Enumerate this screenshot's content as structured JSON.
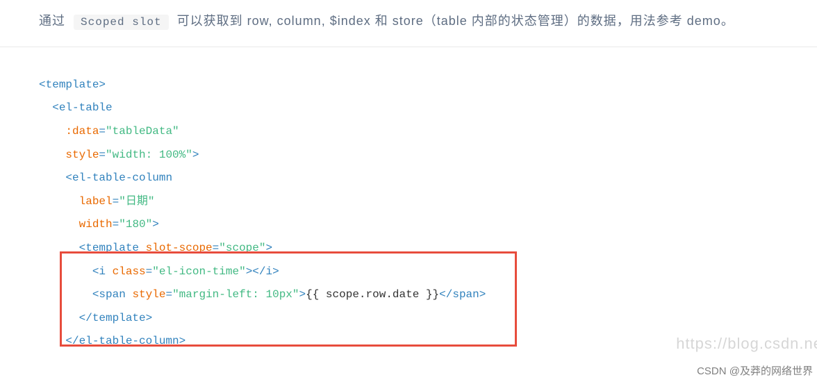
{
  "description": {
    "before": "通过",
    "code_label": "Scoped slot",
    "after": "可以获取到 row, column, $index 和 store（table 内部的状态管理）的数据，用法参考 demo。"
  },
  "code": {
    "lines": [
      {
        "indent": 0,
        "tokens": [
          [
            "punct",
            "<"
          ],
          [
            "tag",
            "template"
          ],
          [
            "punct",
            ">"
          ]
        ]
      },
      {
        "indent": 1,
        "tokens": [
          [
            "punct",
            "<"
          ],
          [
            "tag",
            "el-table"
          ]
        ]
      },
      {
        "indent": 2,
        "tokens": [
          [
            "attr-name",
            ":data"
          ],
          [
            "punct",
            "="
          ],
          [
            "attr-val",
            "\"tableData\""
          ]
        ]
      },
      {
        "indent": 2,
        "tokens": [
          [
            "attr-name",
            "style"
          ],
          [
            "punct",
            "="
          ],
          [
            "attr-val",
            "\"width: 100%\""
          ],
          [
            "punct",
            ">"
          ]
        ]
      },
      {
        "indent": 2,
        "tokens": [
          [
            "punct",
            "<"
          ],
          [
            "tag",
            "el-table-column"
          ]
        ]
      },
      {
        "indent": 3,
        "tokens": [
          [
            "attr-name",
            "label"
          ],
          [
            "punct",
            "="
          ],
          [
            "attr-val",
            "\"日期\""
          ]
        ]
      },
      {
        "indent": 3,
        "tokens": [
          [
            "attr-name",
            "width"
          ],
          [
            "punct",
            "="
          ],
          [
            "attr-val",
            "\"180\""
          ],
          [
            "punct",
            ">"
          ]
        ]
      },
      {
        "indent": 3,
        "tokens": [
          [
            "punct",
            "<"
          ],
          [
            "tag",
            "template"
          ],
          [
            "plain",
            " "
          ],
          [
            "attr-name",
            "slot-scope"
          ],
          [
            "punct",
            "="
          ],
          [
            "attr-val",
            "\"scope\""
          ],
          [
            "punct",
            ">"
          ]
        ]
      },
      {
        "indent": 4,
        "tokens": [
          [
            "punct",
            "<"
          ],
          [
            "tag",
            "i"
          ],
          [
            "plain",
            " "
          ],
          [
            "attr-name",
            "class"
          ],
          [
            "punct",
            "="
          ],
          [
            "attr-val",
            "\"el-icon-time\""
          ],
          [
            "punct",
            "></"
          ],
          [
            "tag",
            "i"
          ],
          [
            "punct",
            ">"
          ]
        ]
      },
      {
        "indent": 4,
        "tokens": [
          [
            "punct",
            "<"
          ],
          [
            "tag",
            "span"
          ],
          [
            "plain",
            " "
          ],
          [
            "attr-name",
            "style"
          ],
          [
            "punct",
            "="
          ],
          [
            "attr-val",
            "\"margin-left: 10px\""
          ],
          [
            "punct",
            ">"
          ],
          [
            "plain",
            "{{ scope.row.date }}"
          ],
          [
            "punct",
            "</"
          ],
          [
            "tag",
            "span"
          ],
          [
            "punct",
            ">"
          ]
        ]
      },
      {
        "indent": 3,
        "tokens": [
          [
            "punct",
            "</"
          ],
          [
            "tag",
            "template"
          ],
          [
            "punct",
            ">"
          ]
        ]
      },
      {
        "indent": 2,
        "tokens": [
          [
            "punct",
            "</"
          ],
          [
            "tag",
            "el-table-column"
          ],
          [
            "punct",
            ">"
          ]
        ]
      }
    ]
  },
  "watermark": {
    "url": "https://blog.csdn.ne",
    "author": "CSDN @及莽的网络世界"
  }
}
